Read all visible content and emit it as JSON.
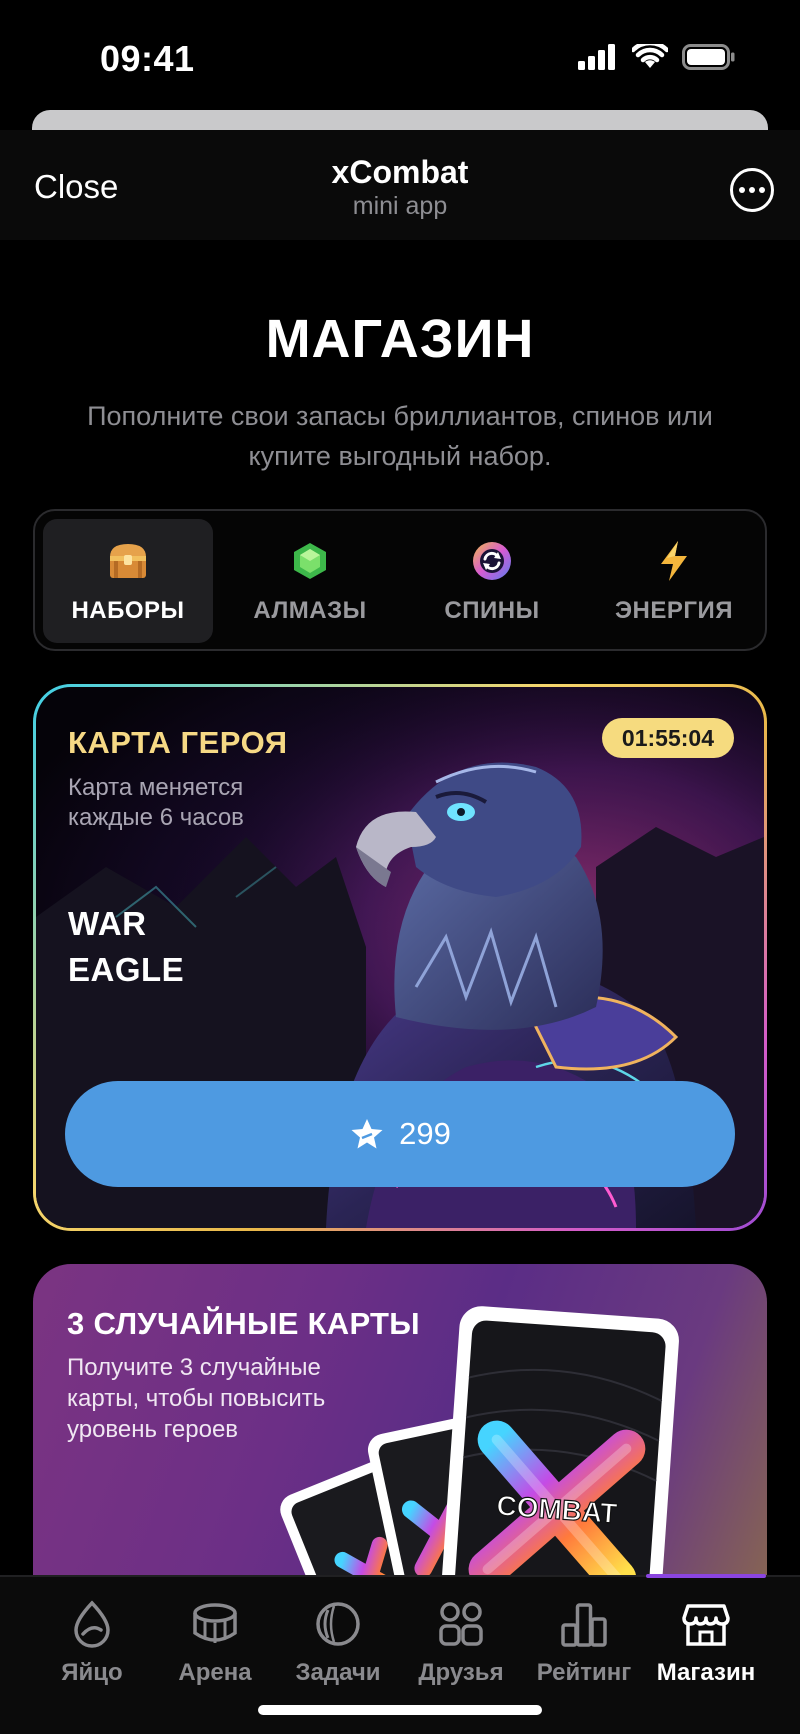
{
  "status_bar": {
    "time": "09:41"
  },
  "header": {
    "close_label": "Close",
    "title": "xCombat",
    "subtitle": "mini app"
  },
  "shop": {
    "title": "МАГАЗИН",
    "description": "Пополните свои запасы бриллиантов, спинов или купите выгодный набор."
  },
  "tabs": [
    {
      "label": "НАБОРЫ",
      "icon": "chest-icon",
      "active": true
    },
    {
      "label": "АЛМАЗЫ",
      "icon": "gem-icon",
      "active": false
    },
    {
      "label": "СПИНЫ",
      "icon": "spin-icon",
      "active": false
    },
    {
      "label": "ЭНЕРГИЯ",
      "icon": "lightning-icon",
      "active": false
    }
  ],
  "hero_card": {
    "title": "КАРТА ГЕРОЯ",
    "description": "Карта меняется каждые 6 часов",
    "hero_name_line1": "WAR",
    "hero_name_line2": "EAGLE",
    "timer": "01:55:04",
    "price": "299",
    "price_icon": "star-icon"
  },
  "pack_card": {
    "title": "3 СЛУЧАЙНЫЕ КАРТЫ",
    "description": "Получите 3 случайные карты, чтобы повысить уровень героев",
    "card_logo_text": "COMBAT"
  },
  "bottom_nav": [
    {
      "label": "Яйцо",
      "icon": "egg-icon",
      "active": false
    },
    {
      "label": "Арена",
      "icon": "arena-icon",
      "active": false
    },
    {
      "label": "Задачи",
      "icon": "tasks-icon",
      "active": false
    },
    {
      "label": "Друзья",
      "icon": "friends-icon",
      "active": false
    },
    {
      "label": "Рейтинг",
      "icon": "rating-icon",
      "active": false
    },
    {
      "label": "Магазин",
      "icon": "shop-icon",
      "active": true
    }
  ],
  "colors": {
    "accent_blue": "#4e9ae1",
    "gold": "#f6d985",
    "timer_bg": "#f6db7f",
    "nav_indicator": "#8b45e0"
  }
}
